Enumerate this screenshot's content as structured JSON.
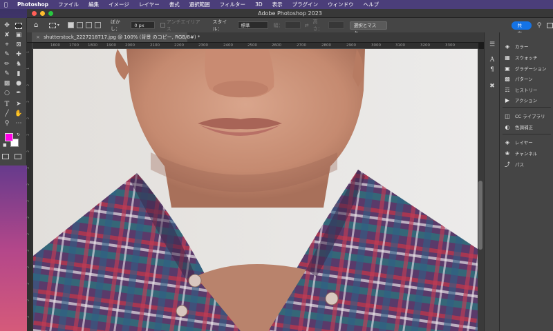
{
  "menubar": {
    "app_name": "Photoshop",
    "items": [
      "ファイル",
      "編集",
      "イメージ",
      "レイヤー",
      "書式",
      "選択範囲",
      "フィルター",
      "3D",
      "表示",
      "プラグイン",
      "ウィンドウ",
      "ヘルプ"
    ]
  },
  "window": {
    "title": "Adobe Photoshop 2023",
    "traffic_colors": [
      "#ff5f57",
      "#febc2e",
      "#28c840"
    ]
  },
  "options_bar": {
    "feather_label": "ぼかし：",
    "feather_value": "0 px",
    "antialias_label": "アンチエイリアス",
    "style_label": "スタイル：",
    "style_value": "標準",
    "width_label": "幅：",
    "height_label": "高さ：",
    "select_mask_button": "選択とマスク...",
    "share_button": "共有"
  },
  "document": {
    "tab_title": "shutterstock_2227218717.jpg @ 100% (背景 のコピー, RGB/8#) *",
    "zoom": "100%"
  },
  "rulers": {
    "horizontal_ticks": [
      "1600",
      "1700",
      "1800",
      "1900",
      "2000",
      "2100",
      "2200",
      "2300",
      "2400",
      "2500",
      "2600",
      "2700",
      "2800",
      "2900",
      "3000",
      "3100",
      "3200",
      "3300"
    ],
    "vertical_ticks": [
      "1",
      "1",
      "2",
      "2",
      "2",
      "2",
      "2",
      "2",
      "2",
      "2",
      "2",
      "2",
      "2",
      "2",
      "2",
      "2",
      "2",
      "2"
    ]
  },
  "colors": {
    "foreground": "#ff00e6",
    "background": "#ffffff",
    "accent": "#1473e6"
  },
  "panels": [
    {
      "label": "カラー",
      "icon": "color-icon"
    },
    {
      "label": "スウォッチ",
      "icon": "swatches-icon"
    },
    {
      "label": "グラデーション",
      "icon": "gradient-icon"
    },
    {
      "label": "パターン",
      "icon": "patterns-icon"
    },
    {
      "label": "ヒストリー",
      "icon": "history-icon"
    },
    {
      "label": "アクション",
      "icon": "actions-icon"
    },
    {
      "label": "CC ライブラリ",
      "icon": "libraries-icon"
    },
    {
      "label": "色調補正",
      "icon": "adjustments-icon"
    },
    {
      "label": "レイヤー",
      "icon": "layers-icon"
    },
    {
      "label": "チャンネル",
      "icon": "channels-icon"
    },
    {
      "label": "パス",
      "icon": "paths-icon"
    }
  ]
}
